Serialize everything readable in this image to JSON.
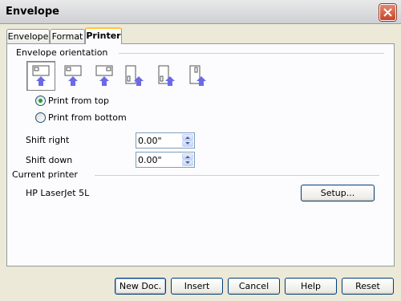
{
  "window": {
    "title": "Envelope"
  },
  "tabs": [
    {
      "label": "Envelope"
    },
    {
      "label": "Format"
    },
    {
      "label": "Printer"
    }
  ],
  "orientation": {
    "section_label": "Envelope orientation"
  },
  "radio": {
    "top_label": "Print from top",
    "bottom_label": "Print from bottom",
    "selected": "top"
  },
  "shift_right": {
    "label": "Shift right",
    "value": "0.00\""
  },
  "shift_down": {
    "label": "Shift down",
    "value": "0.00\""
  },
  "printer": {
    "section_label": "Current printer",
    "name": "HP LaserJet 5L",
    "setup_label": "Setup..."
  },
  "buttons": {
    "new_doc": "New Doc.",
    "insert": "Insert",
    "cancel": "Cancel",
    "help": "Help",
    "reset": "Reset"
  },
  "colors": {
    "accent_tab": "#ffc83c",
    "arrow": "#6a6ae8",
    "radio_dot": "#21a121"
  }
}
